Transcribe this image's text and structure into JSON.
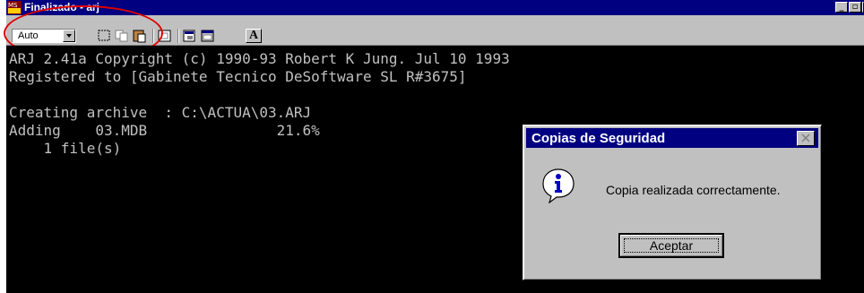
{
  "window": {
    "title": "Finalizado - arj",
    "icon": "ms-dos-icon",
    "buttons": {
      "minimize": "_",
      "maximize": "▫",
      "close": "x"
    }
  },
  "toolbar": {
    "font_size_value": "Auto",
    "font_button_label": "A",
    "buttons": [
      "mark-icon",
      "copy-icon",
      "paste-icon",
      "fullscreen-icon",
      "properties-icon",
      "background-icon",
      "font-icon"
    ]
  },
  "console": {
    "lines": [
      "ARJ 2.41a Copyright (c) 1990-93 Robert K Jung. Jul 10 1993",
      "Registered to [Gabinete Tecnico DeSoftware SL R#3675]",
      "",
      "Creating archive  : C:\\ACTUA\\03.ARJ",
      "Adding    03.MDB               21.6%",
      "    1 file(s)"
    ]
  },
  "dialog": {
    "title": "Copias de Seguridad",
    "message": "Copia realizada correctamente.",
    "ok_label": "Aceptar",
    "icon": "info-icon"
  },
  "colors": {
    "title_bar": "#000080",
    "console_bg": "#000000",
    "console_text": "#c0c0c0",
    "annotation": "#e00000",
    "face": "#c0c0c0"
  }
}
